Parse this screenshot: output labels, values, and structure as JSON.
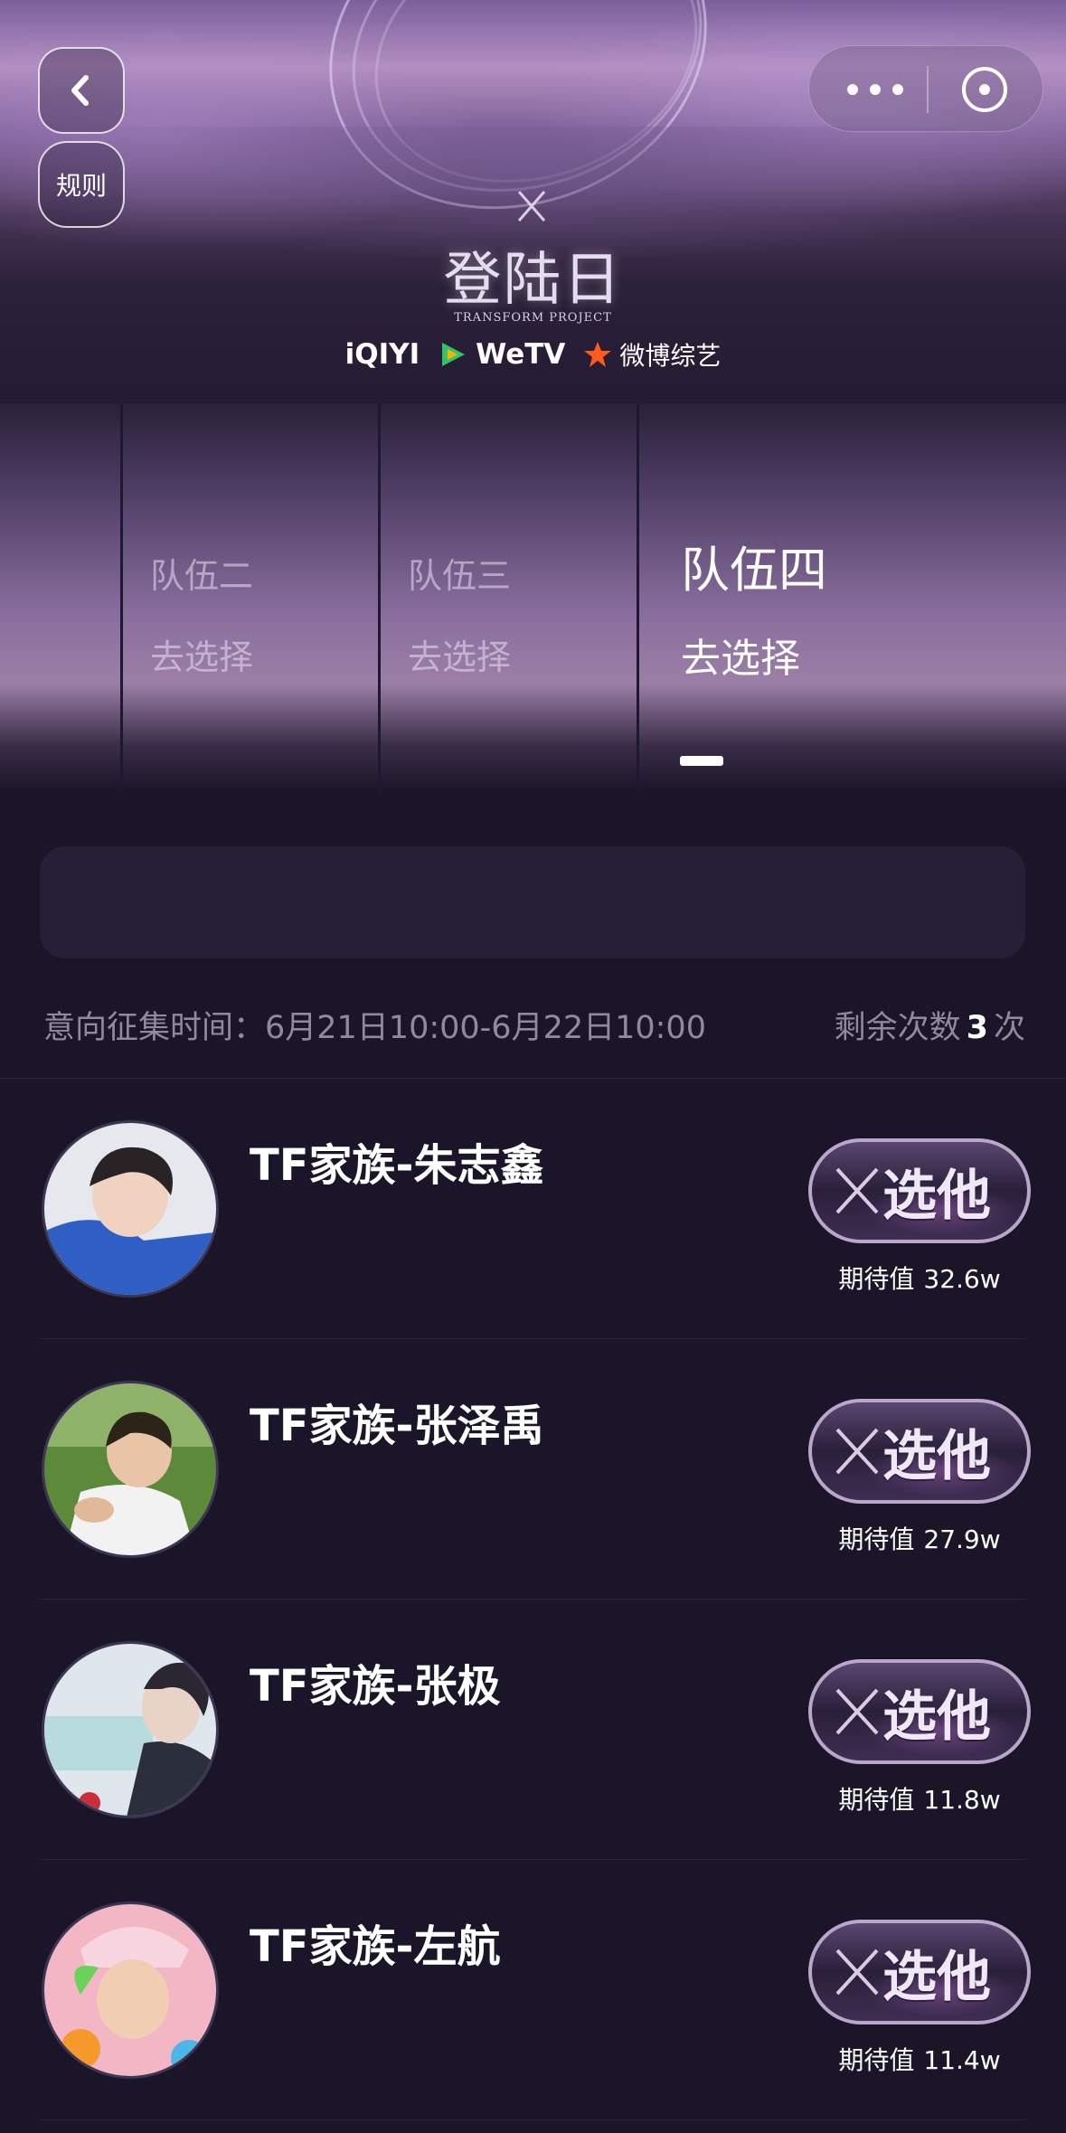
{
  "header": {
    "back_icon": "chevron-left-icon",
    "rules_label": "规则",
    "more_icon": "more-icon",
    "close_icon": "close-circle-icon"
  },
  "banner": {
    "logo_text": "登陆日",
    "logo_subtitle": "TRANSFORM PROJECT",
    "sponsors": [
      "iQIYI",
      "WeTV",
      "微博综艺"
    ]
  },
  "tabs": [
    {
      "name": "队伍二",
      "action": "去选择",
      "active": false
    },
    {
      "name": "队伍三",
      "action": "去选择",
      "active": false
    },
    {
      "name": "队伍四",
      "action": "去选择",
      "active": true
    }
  ],
  "meta": {
    "time_label": "意向征集时间：6月21日10:00-6月22日10:00",
    "remaining_prefix": "剩余次数",
    "remaining_count": "3",
    "remaining_suffix": "次"
  },
  "candidates": [
    {
      "name": "TF家族-朱志鑫",
      "button": "选他",
      "expect_label": "期待值",
      "expect_value": "32.6w"
    },
    {
      "name": "TF家族-张泽禹",
      "button": "选他",
      "expect_label": "期待值",
      "expect_value": "27.9w"
    },
    {
      "name": "TF家族-张极",
      "button": "选他",
      "expect_label": "期待值",
      "expect_value": "11.8w"
    },
    {
      "name": "TF家族-左航",
      "button": "选他",
      "expect_label": "期待值",
      "expect_value": "11.4w"
    }
  ],
  "colors": {
    "background": "#1a1528",
    "accent": "#b9a6c9",
    "muted_text": "#8f8a9e"
  }
}
